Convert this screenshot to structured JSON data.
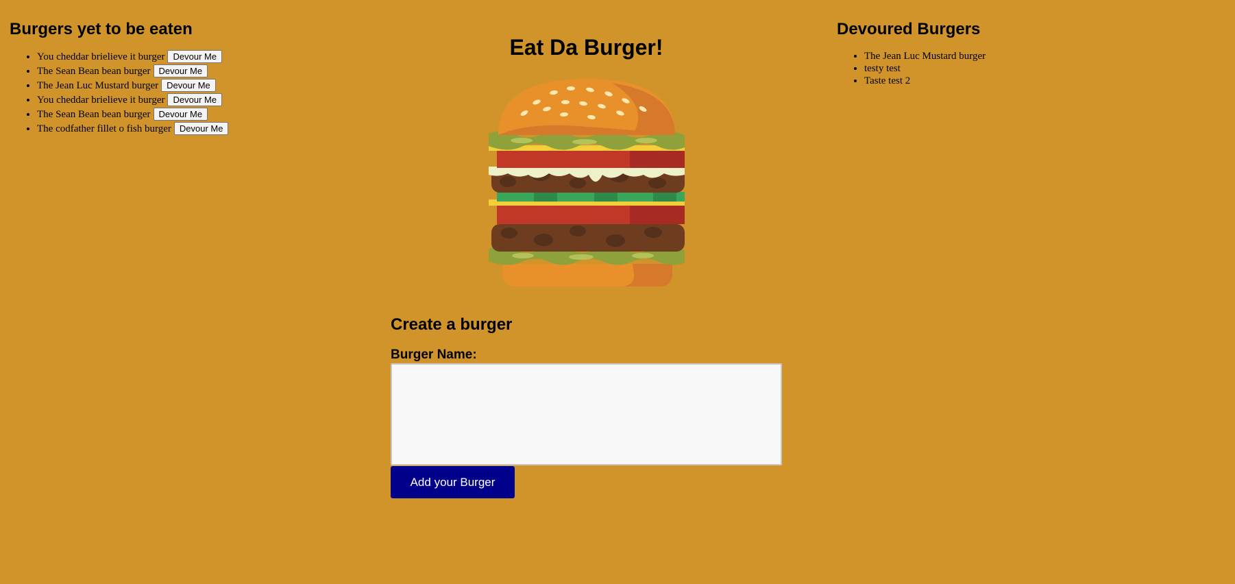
{
  "page_title": "Eat Da Burger!",
  "uneaten": {
    "heading": "Burgers yet to be eaten",
    "devour_label": "Devour Me",
    "items": [
      "You cheddar brielieve it burger",
      "The Sean Bean bean burger",
      "The Jean Luc Mustard burger",
      "You cheddar brielieve it burger",
      "The Sean Bean bean burger",
      "The codfather fillet o fish burger"
    ]
  },
  "devoured": {
    "heading": "Devoured Burgers",
    "items": [
      "The Jean Luc Mustard burger",
      "testy test",
      "Taste test 2"
    ]
  },
  "form": {
    "heading": "Create a burger",
    "name_label": "Burger Name:",
    "name_value": "",
    "submit_label": "Add your Burger"
  },
  "colors": {
    "background": "#d0942a",
    "submit_button": "#00008b"
  }
}
